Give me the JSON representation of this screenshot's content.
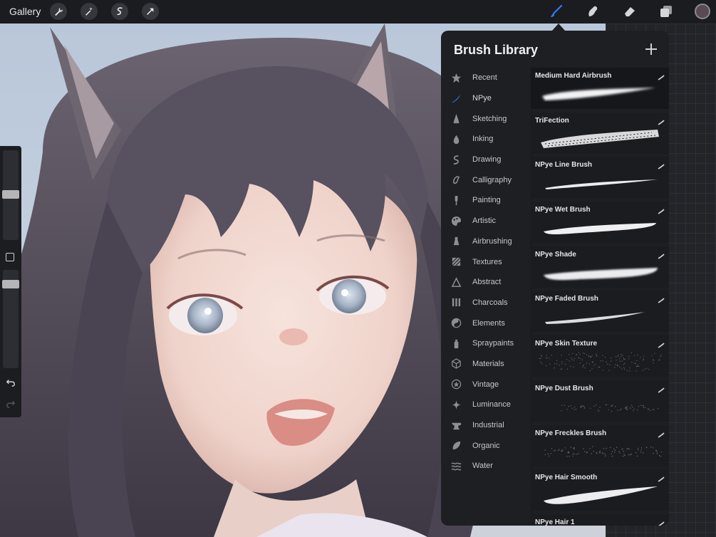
{
  "topbar": {
    "gallery_label": "Gallery",
    "left_tools": [
      {
        "name": "wrench-icon"
      },
      {
        "name": "magic-wand-icon"
      },
      {
        "name": "selection-icon"
      },
      {
        "name": "transform-arrow-icon"
      }
    ],
    "right_tools": [
      {
        "name": "brush-icon",
        "active": true,
        "color": "#2f7cf6"
      },
      {
        "name": "smudge-icon"
      },
      {
        "name": "eraser-icon"
      },
      {
        "name": "layers-icon"
      }
    ],
    "current_color": "#5a4a52"
  },
  "library": {
    "title": "Brush Library",
    "categories": [
      {
        "label": "Recent",
        "icon": "star-icon"
      },
      {
        "label": "NPye",
        "icon": "brush-stroke-icon",
        "active": true
      },
      {
        "label": "Sketching",
        "icon": "pencil-tip-icon"
      },
      {
        "label": "Inking",
        "icon": "ink-drop-icon"
      },
      {
        "label": "Drawing",
        "icon": "squiggle-icon"
      },
      {
        "label": "Calligraphy",
        "icon": "calligraphy-icon"
      },
      {
        "label": "Painting",
        "icon": "paint-brush-icon"
      },
      {
        "label": "Artistic",
        "icon": "palette-icon"
      },
      {
        "label": "Airbrushing",
        "icon": "airbrush-icon"
      },
      {
        "label": "Textures",
        "icon": "texture-icon"
      },
      {
        "label": "Abstract",
        "icon": "triangle-icon"
      },
      {
        "label": "Charcoals",
        "icon": "charcoal-icon"
      },
      {
        "label": "Elements",
        "icon": "yin-yang-icon"
      },
      {
        "label": "Spraypaints",
        "icon": "spray-can-icon"
      },
      {
        "label": "Materials",
        "icon": "cube-icon"
      },
      {
        "label": "Vintage",
        "icon": "vintage-star-icon"
      },
      {
        "label": "Luminance",
        "icon": "sparkle-icon"
      },
      {
        "label": "Industrial",
        "icon": "anvil-icon"
      },
      {
        "label": "Organic",
        "icon": "leaf-icon"
      },
      {
        "label": "Water",
        "icon": "waves-icon"
      }
    ],
    "brushes": [
      {
        "name": "Medium Hard Airbrush",
        "selected": true,
        "stroke": "airbrush"
      },
      {
        "name": "TriFection",
        "stroke": "texture"
      },
      {
        "name": "NPye Line Brush",
        "stroke": "thin"
      },
      {
        "name": "NPye Wet Brush",
        "stroke": "wet"
      },
      {
        "name": "NPye Shade",
        "stroke": "shade"
      },
      {
        "name": "NPye Faded Brush",
        "stroke": "faded"
      },
      {
        "name": "NPye Skin Texture",
        "stroke": "speckle"
      },
      {
        "name": "NPye Dust Brush",
        "stroke": "dust"
      },
      {
        "name": "NPye Freckles Brush",
        "stroke": "freckles"
      },
      {
        "name": "NPye Hair Smooth",
        "stroke": "hair"
      },
      {
        "name": "NPye Hair 1",
        "stroke": "thin"
      }
    ]
  }
}
